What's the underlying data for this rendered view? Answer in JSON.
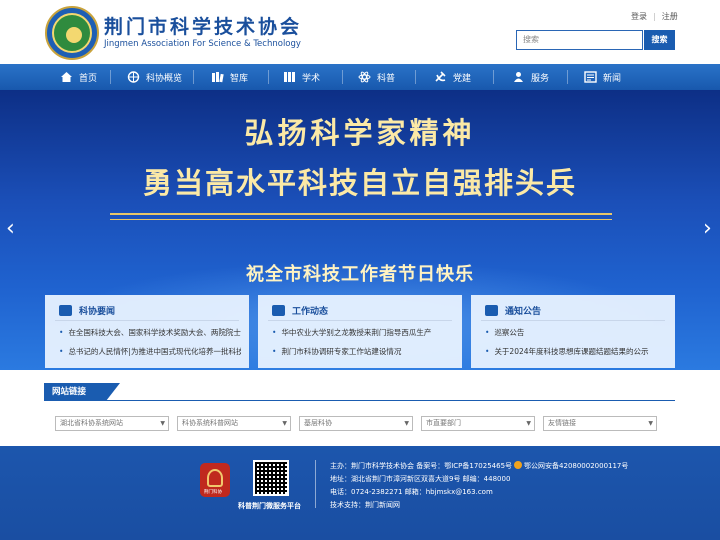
{
  "header": {
    "site_title": "荆门市科学技术协会",
    "site_subtitle": "Jingmen Association For Science & Technology",
    "login": "登录",
    "register": "注册",
    "search_placeholder": "搜索",
    "search_button": "搜索"
  },
  "nav": [
    {
      "label": "首页",
      "icon": "home-icon"
    },
    {
      "label": "科协概览",
      "icon": "globe-icon"
    },
    {
      "label": "智库",
      "icon": "books-icon"
    },
    {
      "label": "学术",
      "icon": "shelf-icon"
    },
    {
      "label": "科普",
      "icon": "atom-icon"
    },
    {
      "label": "党建",
      "icon": "party-icon"
    },
    {
      "label": "服务",
      "icon": "service-icon"
    },
    {
      "label": "新闻",
      "icon": "news-icon"
    }
  ],
  "banner": {
    "line1": "弘扬科学家精神",
    "line2": "勇当高水平科技自立自强排头兵",
    "line3": "祝全市科技工作者节日快乐",
    "prev": "‹",
    "next": "›"
  },
  "cards": [
    {
      "title": "科协要闻",
      "items": [
        "在全国科技大会、国家科学技术奖励大会、两院院士大会上的讲话",
        "总书记的人民情怀|为推进中国式现代化培养一批科技人才"
      ]
    },
    {
      "title": "工作动态",
      "items": [
        "华中农业大学别之龙教授来荆门指导西瓜生产",
        "荆门市科协调研专家工作站建设情况"
      ]
    },
    {
      "title": "通知公告",
      "items": [
        "巡察公告",
        "关于2024年度科技思想库课题结题结果的公示"
      ]
    }
  ],
  "links": {
    "title": "网站链接",
    "selects": [
      "湖北省科协系统网站",
      "科协系统科普网站",
      "基层科协",
      "市直要部门",
      "友情链接"
    ]
  },
  "footer": {
    "logo_text": "荆门科协",
    "qr_label": "科普荆门微服务平台",
    "sponsor": "主办：荆门市科学技术协会  备案号：鄂ICP备17025465号",
    "police": "鄂公网安备42080002000117号",
    "address": "地址：湖北省荆门市漳河新区双喜大道9号  邮编：448000",
    "phone": "电话：0724-2382271  邮箱：hbjmskx@163.com",
    "tech": "技术支持：荆门新闻网"
  }
}
